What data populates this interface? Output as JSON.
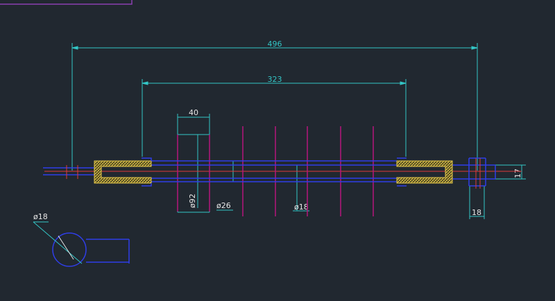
{
  "colors": {
    "background": "#212830",
    "dimension": "#33c6c6",
    "outline": "#2f3ee8",
    "centerline": "#e03a3a",
    "shed": "#b5157c",
    "hatch": "#e2c64a",
    "white": "#e6e6e6",
    "frame": "#8b3fb0"
  },
  "dimensions": {
    "overall_length": "496",
    "core_length": "323",
    "shed_spacing": "40",
    "shed_diameter": "ø92",
    "housing_diameter": "ø26",
    "rod_diameter": "ø18",
    "end_thickness": "18",
    "end_height": "17",
    "detail_hole": "ø18"
  }
}
